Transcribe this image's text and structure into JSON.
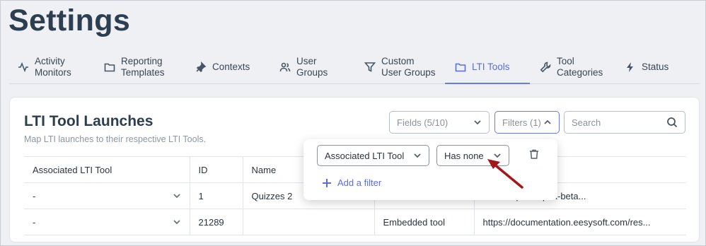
{
  "page": {
    "title": "Settings"
  },
  "tabs": [
    {
      "label_line1": "Activity",
      "label_line2": "Monitors",
      "icon": "activity-icon"
    },
    {
      "label_line1": "Reporting",
      "label_line2": "Templates",
      "icon": "folder-icon"
    },
    {
      "label_line1": "Contexts",
      "label_line2": "",
      "icon": "pin-icon"
    },
    {
      "label_line1": "User",
      "label_line2": "Groups",
      "icon": "users-icon"
    },
    {
      "label_line1": "Custom",
      "label_line2": "User Groups",
      "icon": "filter-icon"
    },
    {
      "label_line1": "LTI Tools",
      "label_line2": "",
      "icon": "folder-icon",
      "active": true
    },
    {
      "label_line1": "Tool",
      "label_line2": "Categories",
      "icon": "wrench-icon"
    },
    {
      "label_line1": "Status",
      "label_line2": "",
      "icon": "bolt-icon"
    }
  ],
  "card": {
    "title": "LTI Tool Launches",
    "subtitle": "Map LTI launches to their respective LTI Tools."
  },
  "controls": {
    "fields_label": "Fields (5/10)",
    "filters_label": "Filters (1)",
    "search_placeholder": "Search"
  },
  "table": {
    "headers": [
      "Associated LTI Tool",
      "ID",
      "Name",
      "",
      ""
    ],
    "rows": [
      {
        "tool": "-",
        "id": "1",
        "name": "Quizzes 2",
        "type": "",
        "url": "ntation.quiz-lti-pdx-beta..."
      },
      {
        "tool": "-",
        "id": "21289",
        "name": "",
        "type": "Embedded tool",
        "url": "https://documentation.eesysoft.com/res..."
      }
    ]
  },
  "filter_popover": {
    "field": "Associated LTI Tool",
    "condition": "Has none",
    "add_label": "Add a filter"
  },
  "colors": {
    "accent": "#5b6ee1",
    "annotation_arrow": "#a3161a",
    "title": "#2c3e4f"
  }
}
